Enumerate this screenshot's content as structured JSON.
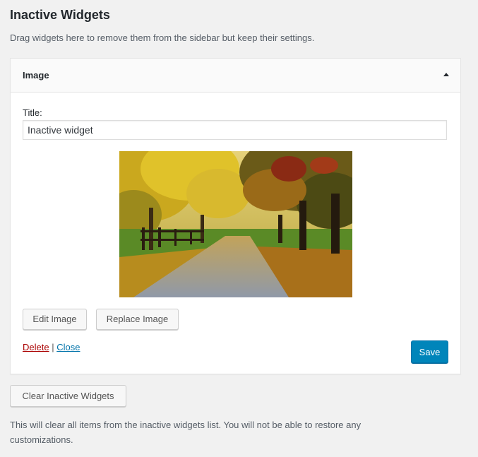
{
  "header": {
    "title": "Inactive Widgets",
    "description": "Drag widgets here to remove them from the sidebar but keep their settings."
  },
  "widget": {
    "name": "Image",
    "toggle_icon": "arrow-up-icon",
    "title_label": "Title:",
    "title_value": "Inactive widget",
    "image_alt": "Autumn tree-lined path",
    "edit_image_label": "Edit Image",
    "replace_image_label": "Replace Image",
    "delete_label": "Delete",
    "separator": "|",
    "close_label": "Close",
    "save_label": "Save"
  },
  "footer": {
    "clear_label": "Clear Inactive Widgets",
    "clear_description": "This will clear all items from the inactive widgets list. You will not be able to restore any customizations."
  },
  "colors": {
    "background": "#f1f1f1",
    "primary_button": "#0085ba",
    "delete_link": "#a00000",
    "close_link": "#0073aa"
  }
}
